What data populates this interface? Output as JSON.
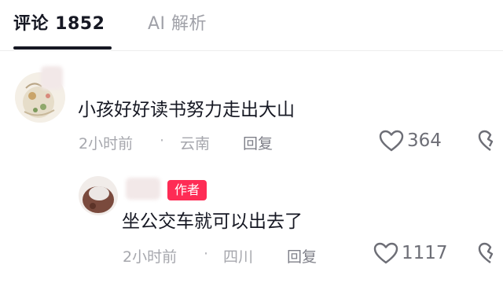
{
  "tabs": {
    "comments_label": "评论 1852",
    "ai_label": "AI 解析"
  },
  "comments": [
    {
      "text": "小孩好好读书努力走出大山",
      "time": "2小时前",
      "separator": "·",
      "location": "云南",
      "reply_label": "回复",
      "likes": "364",
      "author_badge": ""
    }
  ],
  "replies": [
    {
      "text": "坐公交车就可以出去了",
      "time": "2小时前",
      "separator": "·",
      "location": "四川",
      "reply_label": "回复",
      "likes": "1117",
      "author_badge": "作者"
    }
  ],
  "colors": {
    "accent": "#fe2c55",
    "text_primary": "#161823",
    "text_meta": "#a6a7ad"
  },
  "icons": {
    "like": "heart-outline-icon",
    "dislike": "broken-heart-icon"
  }
}
